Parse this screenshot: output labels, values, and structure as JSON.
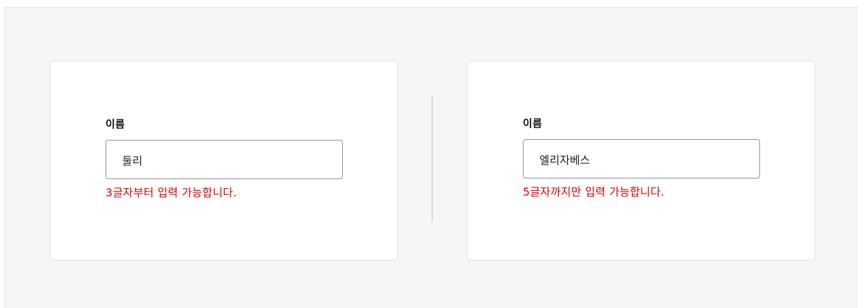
{
  "colors": {
    "background": "#f6f6f6",
    "card": "#ffffff",
    "error": "#e00000",
    "input_border": "#8f8f8f"
  },
  "left_form": {
    "label": "이름",
    "input_value": "둘리",
    "error_message": "3글자부터 입력 가능합니다."
  },
  "right_form": {
    "label": "이름",
    "input_value": "엘리자베스",
    "error_message": "5글자까지만 입력 가능합니다."
  }
}
